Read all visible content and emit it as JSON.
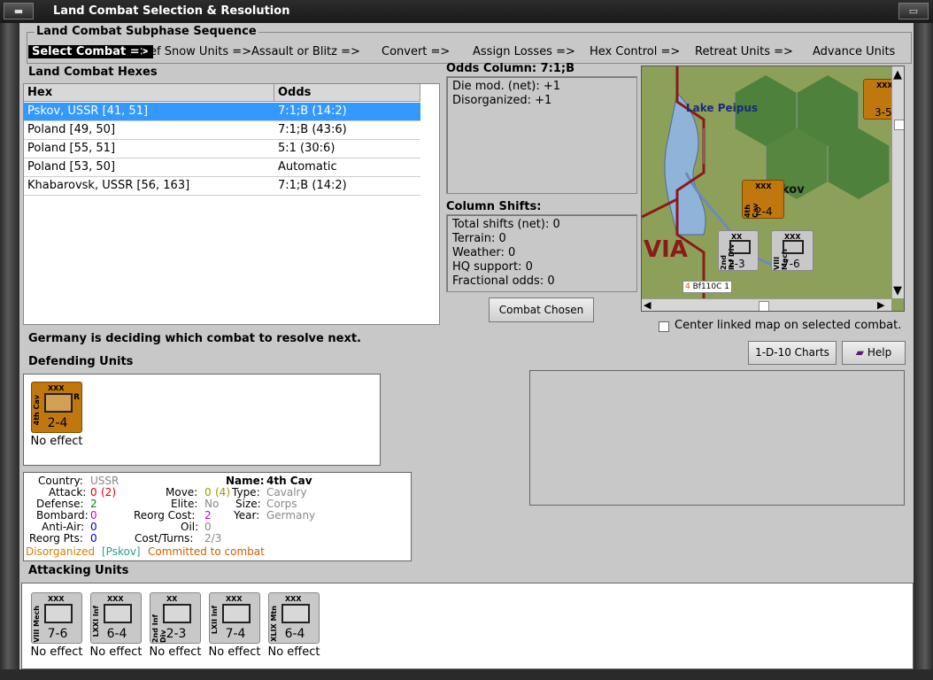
{
  "window": {
    "title": "Land Combat Selection & Resolution"
  },
  "sequence": {
    "title": "Land Combat Subphase Sequence",
    "steps": [
      "Select Combat =>",
      "Def Snow Units =>",
      "Assault or Blitz =>",
      "Convert =>",
      "Assign Losses =>",
      "Hex Control =>",
      "Retreat Units =>",
      "Advance Units"
    ]
  },
  "hexes": {
    "title": "Land Combat Hexes",
    "columns": [
      "Hex",
      "Odds"
    ],
    "rows": [
      {
        "hex": "Pskov, USSR [41, 51]",
        "odds": "7:1;B (14:2)"
      },
      {
        "hex": "Poland [49, 50]",
        "odds": "7:1;B (43:6)"
      },
      {
        "hex": "Poland [55, 51]",
        "odds": "5:1 (30:6)"
      },
      {
        "hex": "Poland [53, 50]",
        "odds": "Automatic"
      },
      {
        "hex": "Khabarovsk, USSR [56, 163]",
        "odds": "7:1;B (14:2)"
      }
    ]
  },
  "odds": {
    "title": "Odds Column: 7:1;B",
    "lines": [
      "Die mod. (net): +1",
      "Disorganized: +1"
    ]
  },
  "shifts": {
    "title": "Column Shifts:",
    "lines": [
      "Total shifts (net): 0",
      "Terrain: 0",
      "Weather: 0",
      "HQ support: 0",
      "Fractional odds: 0"
    ]
  },
  "buttons": {
    "combat_chosen": "Combat Chosen",
    "charts": "1-D-10 Charts",
    "help": "Help"
  },
  "map": {
    "lake": "Lake Peipus",
    "city": "kov",
    "region": "VIA",
    "air": "Bf110C 1",
    "air_num": "4"
  },
  "center_map_label": "Center linked map on selected combat.",
  "status": "Germany is deciding which combat to resolve next.",
  "defending": {
    "title": "Defending Units",
    "units": [
      {
        "name": "4th Cav",
        "size": "XXX",
        "value": "2-4",
        "tag": "R",
        "effect": "No effect"
      }
    ]
  },
  "details": {
    "country_label": "Country:",
    "country": "USSR",
    "attack_label": "Attack:",
    "attack": "0",
    "attack_paren": "(2)",
    "defense_label": "Defense:",
    "defense": "2",
    "bombard_label": "Bombard:",
    "bombard": "0",
    "antiair_label": "Anti-Air:",
    "antiair": "0",
    "reorgpts_label": "Reorg Pts:",
    "reorgpts": "0",
    "move_label": "Move:",
    "move": "0",
    "move_paren": "(4)",
    "elite_label": "Elite:",
    "elite": "No",
    "reorgcost_label": "Reorg Cost:",
    "reorgcost": "2",
    "oil_label": "Oil:",
    "oil": "0",
    "costturns_label": "Cost/Turns:",
    "costturns": "2/3",
    "name_label": "Name:",
    "name": "4th Cav",
    "type_label": "Type:",
    "type": "Cavalry",
    "size_label": "Size:",
    "size": "Corps",
    "year_label": "Year:",
    "year": "Germany",
    "status1": "Disorganized",
    "status2": "[Pskov]",
    "status3": "Committed to combat"
  },
  "attacking": {
    "title": "Attacking Units",
    "units": [
      {
        "name": "VIII Mech",
        "size": "XXX",
        "value": "7-6",
        "effect": "No effect"
      },
      {
        "name": "LXXI Inf",
        "size": "XXX",
        "value": "6-4",
        "effect": "No effect"
      },
      {
        "name": "2nd Inf Div",
        "size": "XX",
        "value": "2-3",
        "effect": "No effect"
      },
      {
        "name": "LXII Inf",
        "size": "XXX",
        "value": "7-4",
        "effect": "No effect"
      },
      {
        "name": "XLIX Mtn",
        "size": "XXX",
        "value": "6-4",
        "effect": "No effect"
      }
    ]
  },
  "map_counters": [
    {
      "name": "2nd Inf Div",
      "size": "XX",
      "value": "2-3"
    },
    {
      "name": "VIII Mech",
      "size": "XXX",
      "value": "7-6"
    },
    {
      "name": "4th Cav",
      "size": "XXX",
      "value": "2-4"
    },
    {
      "name": "",
      "size": "XXX",
      "value": "3-5"
    }
  ],
  "colors": {
    "accent_select": "#3399ff",
    "ussr": "#c0780e",
    "germany": "#c8c8c8",
    "disorganized": "#d08000",
    "pskov": "#2a9d8f",
    "committed": "#d06000"
  }
}
